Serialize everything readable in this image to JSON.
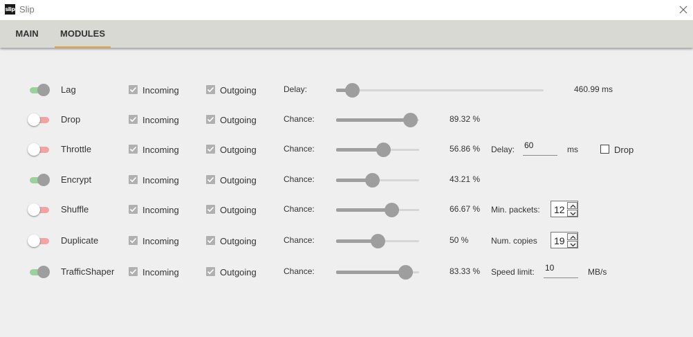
{
  "window": {
    "logo_text": "slip",
    "title": "Slip"
  },
  "tabs": [
    {
      "label": "MAIN",
      "active": false
    },
    {
      "label": "MODULES",
      "active": true
    }
  ],
  "colors": {
    "accent": "#e8a33a",
    "toggle_on": "#9bd29b",
    "toggle_off": "#f2a3a3",
    "control_grey": "#9e9e9e"
  },
  "checkbox_labels": {
    "incoming": "Incoming",
    "outgoing": "Outgoing"
  },
  "modules": {
    "lag": {
      "name": "Lag",
      "enabled": true,
      "incoming": true,
      "outgoing": true,
      "param_label": "Delay:",
      "slider_fraction": 0.075,
      "value_text": "460.99 ms"
    },
    "drop": {
      "name": "Drop",
      "enabled": false,
      "incoming": true,
      "outgoing": true,
      "param_label": "Chance:",
      "slider_fraction": 0.8932,
      "value_text": "89.32 %"
    },
    "throttle": {
      "name": "Throttle",
      "enabled": false,
      "incoming": true,
      "outgoing": true,
      "param_label": "Chance:",
      "slider_fraction": 0.5686,
      "value_text": "56.86 %",
      "delay_label": "Delay:",
      "delay_value": "60",
      "delay_unit": "ms",
      "drop_label": "Drop",
      "drop_checked": false
    },
    "encrypt": {
      "name": "Encrypt",
      "enabled": true,
      "incoming": true,
      "outgoing": true,
      "param_label": "Chance:",
      "slider_fraction": 0.4321,
      "value_text": "43.21 %"
    },
    "shuffle": {
      "name": "Shuffle",
      "enabled": false,
      "incoming": true,
      "outgoing": true,
      "param_label": "Chance:",
      "slider_fraction": 0.6667,
      "value_text": "66.67 %",
      "extra_label": "Min. packets:",
      "extra_value": "12"
    },
    "duplicate": {
      "name": "Duplicate",
      "enabled": false,
      "incoming": true,
      "outgoing": true,
      "param_label": "Chance:",
      "slider_fraction": 0.5,
      "value_text": "50 %",
      "extra_label": "Num. copies",
      "extra_value": "19"
    },
    "trafficshaper": {
      "name": "TrafficShaper",
      "enabled": true,
      "incoming": true,
      "outgoing": true,
      "param_label": "Chance:",
      "slider_fraction": 0.8333,
      "value_text": "83.33 %",
      "extra_label": "Speed limit:",
      "extra_value": "10",
      "extra_unit": "MB/s"
    }
  }
}
